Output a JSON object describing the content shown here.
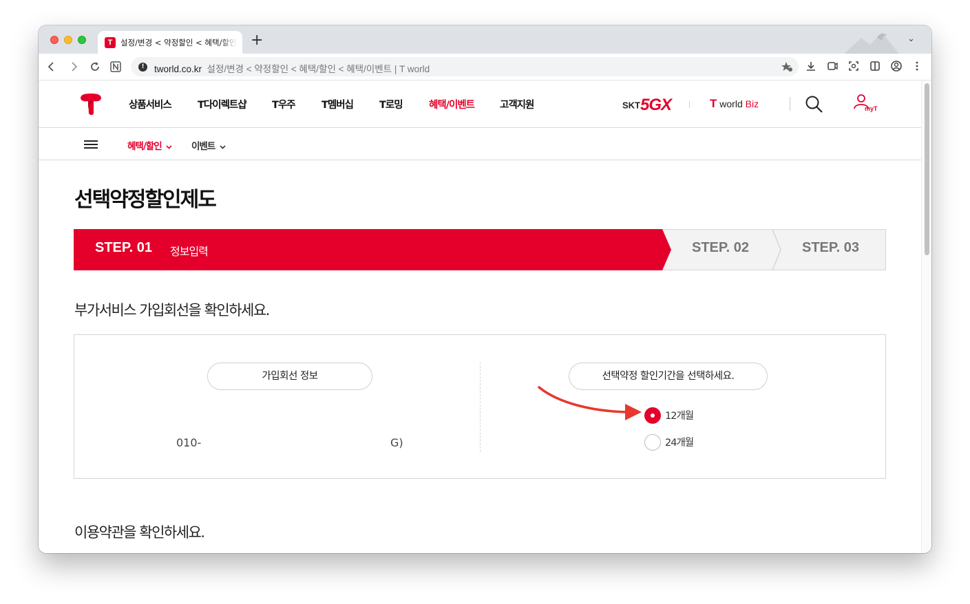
{
  "browser": {
    "tab_title": "설정/변경 < 약정할인 < 혜택/할인 < 혜택/이벤트 | T world",
    "new_tab": "+",
    "tab_menu": "⌄",
    "url_domain": "tworld.co.kr",
    "url_page_title": "설정/변경 < 약정할인 < 혜택/할인 < 혜택/이벤트 | T world"
  },
  "gnb": {
    "menu": [
      "상품서비스",
      "T다이렉트샵",
      "T우주",
      "T멤버십",
      "T로밍",
      "혜택/이벤트",
      "고객지원"
    ],
    "active_index": 5,
    "skt_label": "SKT",
    "fiveg_label": "5G",
    "x_label": "X",
    "worldbiz_t": "T",
    "worldbiz_world": "world",
    "worldbiz_biz": "Biz",
    "myt_label": "myT"
  },
  "lnb": {
    "items": [
      {
        "label": "혜택/할인",
        "active": true
      },
      {
        "label": "이벤트",
        "active": false
      }
    ]
  },
  "page_title": "선택약정할인제도",
  "steps": [
    {
      "label": "STEP. 01",
      "sub": "정보입력",
      "active": true
    },
    {
      "label": "STEP. 02",
      "active": false
    },
    {
      "label": "STEP. 03",
      "active": false
    }
  ],
  "section1_title": "부가서비스 가입회선을 확인하세요.",
  "line_info": {
    "header": "가입회선 정보",
    "number": "010-",
    "plan": "G)"
  },
  "period": {
    "header": "선택약정 할인기간을 선택하세요.",
    "options": [
      {
        "label": "12개월",
        "selected": true
      },
      {
        "label": "24개월",
        "selected": false
      }
    ]
  },
  "section2_title": "이용약관을 확인하세요.",
  "colors": {
    "brand_red": "#e4002b",
    "annotation_arrow": "#e8372c"
  }
}
